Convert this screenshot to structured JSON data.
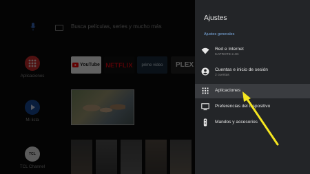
{
  "home": {
    "search_placeholder": "Busca películas, series y mucho más",
    "sidebar": [
      {
        "label": "Aplicaciones",
        "icon": "apps-grid-icon",
        "color": "#d32f2f"
      },
      {
        "label": "Mi lista",
        "icon": "add-to-list-icon",
        "color": "#1a4d9e"
      },
      {
        "label": "TCL Channel",
        "icon": "tcl-channel-icon",
        "color": "#f0f0f0"
      }
    ],
    "apps": [
      {
        "label": "YouTube",
        "icon": "youtube-icon"
      },
      {
        "label": "NETFLIX",
        "icon": "netflix-icon"
      },
      {
        "label": "prime video",
        "icon": "prime-video-icon"
      },
      {
        "label": "PLEX",
        "icon": "plex-icon"
      }
    ]
  },
  "settings": {
    "title": "Ajustes",
    "section_title": "Ajustes generales",
    "items": [
      {
        "label": "Red e Internet",
        "sublabel": "KAPROTE 2.4G",
        "icon": "wifi-icon"
      },
      {
        "label": "Cuentas e inicio de sesión",
        "sublabel": "2 cuentas",
        "icon": "account-icon"
      },
      {
        "label": "Aplicaciones",
        "sublabel": "",
        "icon": "apps-grid-icon",
        "focused": true
      },
      {
        "label": "Preferencias del dispositivo",
        "sublabel": "",
        "icon": "tv-icon"
      },
      {
        "label": "Mandos y accesorios",
        "sublabel": "",
        "icon": "remote-icon"
      }
    ]
  },
  "colors": {
    "panel_background": "#232528",
    "focused_row": "#3a3c40",
    "section_accent": "#7fb0e8",
    "annotation_arrow": "#f5e620"
  }
}
